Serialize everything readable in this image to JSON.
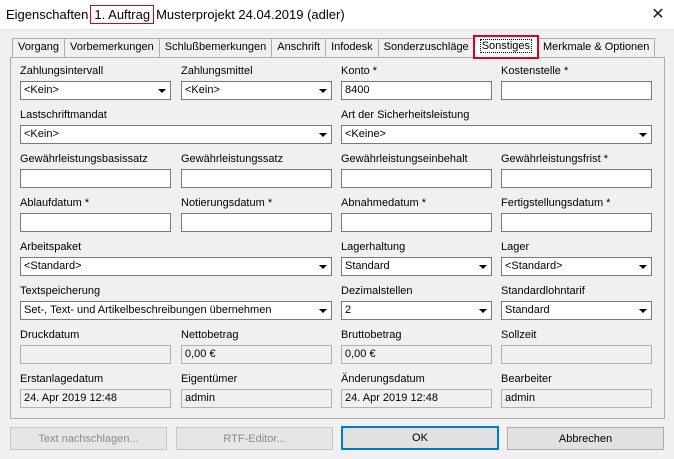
{
  "window": {
    "title_prefix": "Eigenschaften",
    "title_highlight": "1. Auftrag",
    "title_suffix": "Musterprojekt 24.04.2019 (adler)",
    "close": "✕"
  },
  "tabs": [
    {
      "label": "Vorgang"
    },
    {
      "label": "Vorbemerkungen"
    },
    {
      "label": "Schlußbemerkungen"
    },
    {
      "label": "Anschrift"
    },
    {
      "label": "Infodesk"
    },
    {
      "label": "Sonderzuschläge"
    },
    {
      "label": "Sonstiges",
      "active": true
    },
    {
      "label": "Merkmale & Optionen"
    }
  ],
  "form": {
    "zahlungsintervall": {
      "label": "Zahlungsintervall",
      "value": "<Kein>"
    },
    "zahlungsmittel": {
      "label": "Zahlungsmittel",
      "value": "<Kein>"
    },
    "konto": {
      "label": "Konto *",
      "value": "8400"
    },
    "kostenstelle": {
      "label": "Kostenstelle *",
      "value": ""
    },
    "lastschriftmandat": {
      "label": "Lastschriftmandat",
      "value": "<Kein>"
    },
    "sicherheitsleistung": {
      "label": "Art der Sicherheitsleistung",
      "value": "<Keine>"
    },
    "gl_basissatz": {
      "label": "Gewährleistungsbasissatz",
      "value": ""
    },
    "gl_satz": {
      "label": "Gewährleistungssatz",
      "value": ""
    },
    "gl_einbehalt": {
      "label": "Gewährleistungseinbehalt",
      "value": ""
    },
    "gl_frist": {
      "label": "Gewährleistungsfrist *",
      "value": ""
    },
    "ablaufdatum": {
      "label": "Ablaufdatum *",
      "value": ""
    },
    "notierungsdatum": {
      "label": "Notierungsdatum *",
      "value": ""
    },
    "abnahmedatum": {
      "label": "Abnahmedatum *",
      "value": ""
    },
    "fertigstellungsdatum": {
      "label": "Fertigstellungsdatum *",
      "value": ""
    },
    "arbeitspaket": {
      "label": "Arbeitspaket",
      "value": "<Standard>"
    },
    "lagerhaltung": {
      "label": "Lagerhaltung",
      "value": "Standard"
    },
    "lager": {
      "label": "Lager",
      "value": "<Standard>"
    },
    "textspeicherung": {
      "label": "Textspeicherung",
      "value": "Set-, Text- und Artikelbeschreibungen übernehmen"
    },
    "dezimalstellen": {
      "label": "Dezimalstellen",
      "value": "2"
    },
    "standardlohntarif": {
      "label": "Standardlohntarif",
      "value": "Standard"
    },
    "druckdatum": {
      "label": "Druckdatum",
      "value": ""
    },
    "nettobetrag": {
      "label": "Nettobetrag",
      "value": "0,00 €"
    },
    "bruttobetrag": {
      "label": "Bruttobetrag",
      "value": "0,00 €"
    },
    "sollzeit": {
      "label": "Sollzeit",
      "value": ""
    },
    "erstanlagedatum": {
      "label": "Erstanlagedatum",
      "value": "24. Apr 2019 12:48"
    },
    "eigentuemer": {
      "label": "Eigentümer",
      "value": "admin"
    },
    "aenderungsdatum": {
      "label": "Änderungsdatum",
      "value": "24. Apr 2019 12:48"
    },
    "bearbeiter": {
      "label": "Bearbeiter",
      "value": "admin"
    }
  },
  "buttons": {
    "text_nachschlagen": "Text nachschlagen...",
    "rtf_editor": "RTF-Editor...",
    "ok": "OK",
    "abbrechen": "Abbrechen"
  }
}
